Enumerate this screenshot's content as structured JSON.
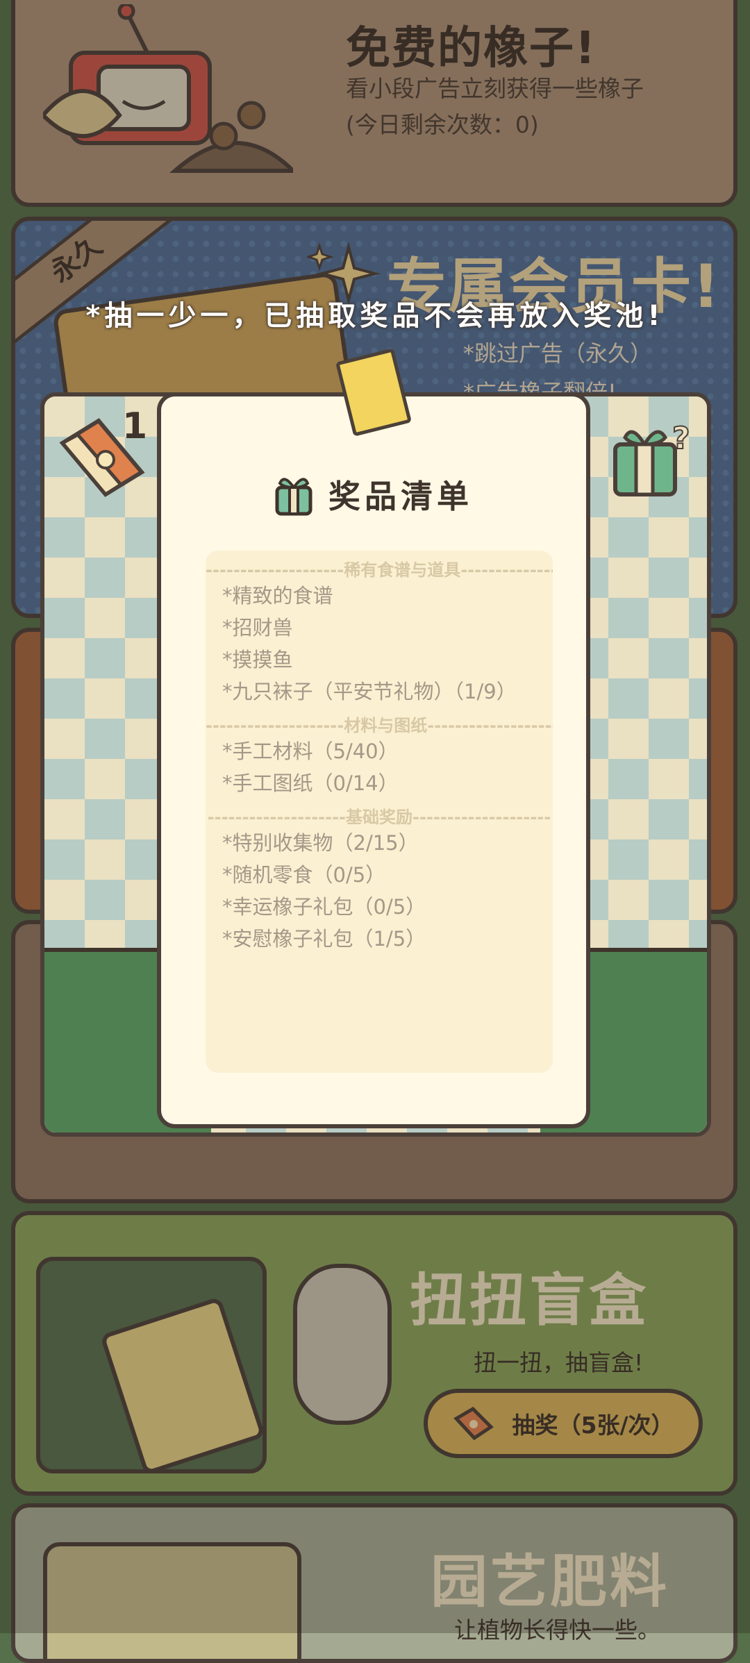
{
  "free_acorns": {
    "title": "免费的橡子!",
    "description": "看小段广告立刻获得一些橡子",
    "remaining": "(今日剩余次数：0)"
  },
  "membership": {
    "ribbon": "永久",
    "title": "专属会员卡!",
    "perks": [
      "*跳过广告（永久）",
      "*广告橡子翻倍!"
    ]
  },
  "lottery": {
    "banner": "*抽一少一，已抽取奖品不会再放入奖池!",
    "ticket_count": "1",
    "list_title": "奖品清单",
    "sections": [
      {
        "heading": "--------------------稀有食谱与道具--------------------",
        "items": [
          "*精致的食谱",
          "*招财兽",
          "*摸摸鱼",
          "*九只袜子（平安节礼物）（1/9）"
        ]
      },
      {
        "heading": "--------------------材料与图纸--------------------",
        "items": [
          "*手工材料（5/40）",
          "*手工图纸（0/14）"
        ]
      },
      {
        "heading": "--------------------基础奖励--------------------",
        "items": [
          "*特别收集物（2/15）",
          "*随机零食（0/5）",
          "*幸运橡子礼包（0/5）",
          "*安慰橡子礼包（1/5）"
        ]
      }
    ]
  },
  "gacha": {
    "title": "扭扭盲盒",
    "subtitle": "扭一扭，抽盲盒!",
    "button_label": "抽奖（5张/次）"
  },
  "fertilizer": {
    "title": "园艺肥料",
    "subtitle": "让植物长得快一些。"
  },
  "colors": {
    "outline": "#4b4039",
    "paper": "#fff9e6",
    "gold": "#d6b25b",
    "blue_card": "#4f6d94",
    "green_card": "#8aa25c"
  }
}
